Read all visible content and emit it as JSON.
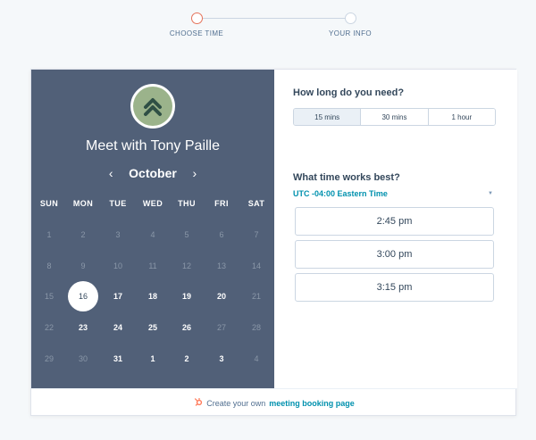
{
  "stepper": {
    "steps": [
      {
        "label": "CHOOSE TIME"
      },
      {
        "label": "YOUR INFO"
      }
    ]
  },
  "calendar": {
    "title": "Meet with Tony Paille",
    "month": "October",
    "prev_arrow": "‹",
    "next_arrow": "›",
    "weekdays": [
      "SUN",
      "MON",
      "TUE",
      "WED",
      "THU",
      "FRI",
      "SAT"
    ],
    "weeks": [
      [
        {
          "d": "1"
        },
        {
          "d": "2"
        },
        {
          "d": "3"
        },
        {
          "d": "4"
        },
        {
          "d": "5"
        },
        {
          "d": "6"
        },
        {
          "d": "7"
        }
      ],
      [
        {
          "d": "8"
        },
        {
          "d": "9"
        },
        {
          "d": "10"
        },
        {
          "d": "11"
        },
        {
          "d": "12"
        },
        {
          "d": "13"
        },
        {
          "d": "14"
        }
      ],
      [
        {
          "d": "15"
        },
        {
          "d": "16",
          "selected": true
        },
        {
          "d": "17",
          "avail": true
        },
        {
          "d": "18",
          "avail": true
        },
        {
          "d": "19",
          "avail": true
        },
        {
          "d": "20",
          "avail": true
        },
        {
          "d": "21"
        }
      ],
      [
        {
          "d": "22"
        },
        {
          "d": "23",
          "avail": true
        },
        {
          "d": "24",
          "avail": true
        },
        {
          "d": "25",
          "avail": true
        },
        {
          "d": "26",
          "avail": true
        },
        {
          "d": "27"
        },
        {
          "d": "28"
        }
      ],
      [
        {
          "d": "29"
        },
        {
          "d": "30"
        },
        {
          "d": "31",
          "avail": true
        },
        {
          "d": "1",
          "avail": true
        },
        {
          "d": "2",
          "avail": true
        },
        {
          "d": "3",
          "avail": true
        },
        {
          "d": "4"
        }
      ]
    ]
  },
  "duration": {
    "question": "How long do you need?",
    "options": [
      "15 mins",
      "30 mins",
      "1 hour"
    ],
    "selected_index": 0
  },
  "times": {
    "question": "What time works best?",
    "timezone": "UTC -04:00 Eastern Time",
    "slots": [
      "2:45 pm",
      "3:00 pm",
      "3:15 pm"
    ]
  },
  "footer": {
    "prefix": "Create your own",
    "link": "meeting booking page"
  },
  "colors": {
    "panel": "#516078",
    "accent": "#0091ae",
    "step_active": "#e5735a",
    "avatar_bg": "#9bb38b"
  }
}
